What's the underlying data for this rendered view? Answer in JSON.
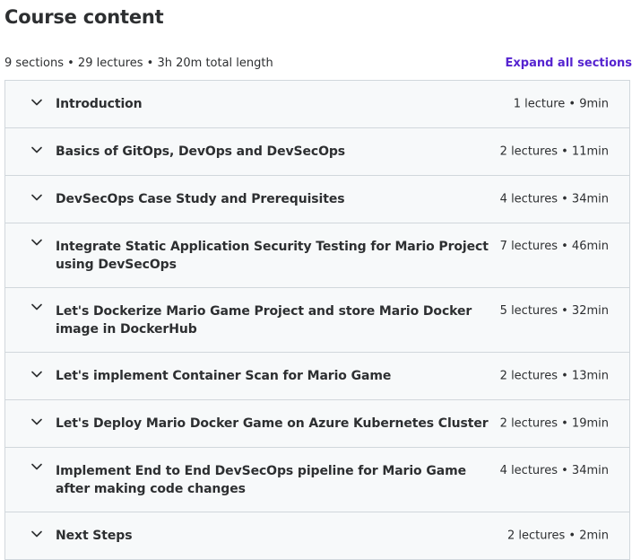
{
  "header": {
    "title": "Course content",
    "summary": "9 sections • 29 lectures • 3h 20m total length",
    "expand_all_label": "Expand all sections"
  },
  "sections": [
    {
      "title": "Introduction",
      "meta": "1 lecture • 9min",
      "icon": "chevron-down-icon"
    },
    {
      "title": "Basics of GitOps, DevOps and DevSecOps",
      "meta": "2 lectures • 11min",
      "icon": "chevron-down-icon"
    },
    {
      "title": "DevSecOps Case Study and Prerequisites",
      "meta": "4 lectures • 34min",
      "icon": "chevron-down-icon"
    },
    {
      "title": "Integrate Static Application Security Testing for Mario Project using DevSecOps",
      "meta": "7 lectures • 46min",
      "icon": "chevron-down-icon"
    },
    {
      "title": "Let's Dockerize Mario Game Project and store Mario Docker image in DockerHub",
      "meta": "5 lectures • 32min",
      "icon": "chevron-down-icon"
    },
    {
      "title": "Let's implement Container Scan for Mario Game",
      "meta": "2 lectures • 13min",
      "icon": "chevron-down-icon"
    },
    {
      "title": "Let's Deploy Mario Docker Game on Azure Kubernetes Cluster",
      "meta": "2 lectures • 19min",
      "icon": "chevron-down-icon"
    },
    {
      "title": "Implement End to End DevSecOps pipeline for Mario Game after making code changes",
      "meta": "4 lectures • 34min",
      "icon": "chevron-down-icon"
    },
    {
      "title": "Next Steps",
      "meta": "2 lectures • 2min",
      "icon": "chevron-down-icon"
    }
  ],
  "colors": {
    "accent": "#5624d0",
    "text": "#2d2f31",
    "section_bg": "#f7f9fa",
    "border": "#d1d7dc"
  }
}
